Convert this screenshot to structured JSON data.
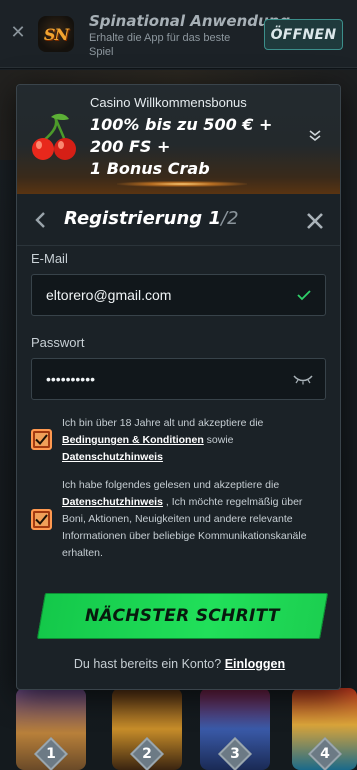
{
  "banner": {
    "close_icon": "close-icon",
    "app_logo_text": "SN",
    "app_name": "Spinational Anwendung",
    "tagline": "Erhalte die App für das beste Spiel",
    "open_label": "ÖFFNEN"
  },
  "bonus": {
    "icon": "cherry-icon",
    "kicker": "Casino Willkommensbonus",
    "title_line1": "100% bis zu 500 € +",
    "title_line2": "200 FS +",
    "title_line3": "1 Bonus Crab",
    "toggle_icon": "chevron-down-icon"
  },
  "registration": {
    "title": "Registrierung",
    "step_current": "1",
    "step_total": "/2",
    "back_icon": "chevron-left-icon",
    "close_icon": "close-icon"
  },
  "form": {
    "email_label": "E-Mail",
    "email_value": "eltorero@gmail.com",
    "password_label": "Passwort",
    "password_value": "••••••••••",
    "email_valid_icon": "checkmark-icon",
    "password_visibility_icon": "eye-closed-icon"
  },
  "consent": {
    "terms": {
      "checked": true,
      "text_before": "Ich bin über 18 Jahre alt und akzeptiere die ",
      "link1": "Bedingungen & Konditionen",
      "text_mid": " sowie ",
      "link2": "Datenschutzhinweis"
    },
    "marketing": {
      "checked": true,
      "text_before": "Ich habe folgendes gelesen und akzeptiere die ",
      "link": "Datenschutzhinweis",
      "text_after": " , Ich möchte regelmäßig über Boni, Aktionen, Neuigkeiten und andere relevante Informationen über beliebige Kommunikationskanäle erhalten."
    }
  },
  "cta": {
    "next_label": "NÄCHSTER SCHRITT",
    "login_prompt": "Du hast bereits ein Konto?",
    "login_link": "Einloggen"
  },
  "games": {
    "ranks": [
      "1",
      "2",
      "3",
      "4"
    ]
  },
  "colors": {
    "accent_green": "#21e05a",
    "checkbox_orange": "#f0a059",
    "banner_button_teal": "#3c8f8b"
  }
}
